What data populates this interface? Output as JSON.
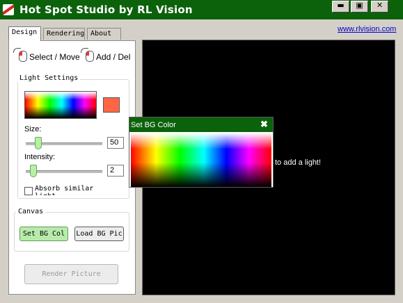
{
  "window": {
    "title": "Hot Spot Studio by RL Vision",
    "minimize_label": "▬",
    "maximize_label": "▣",
    "close_label": "✕"
  },
  "tabs": [
    {
      "label": "Design"
    },
    {
      "label": "Rendering"
    },
    {
      "label": "About"
    }
  ],
  "header_link": "www.rlvision.com",
  "modes": {
    "select_move": "Select / Move",
    "add_del": "Add / Del"
  },
  "light_settings": {
    "title": "Light Settings",
    "color": "#ff6644",
    "size_label": "Size:",
    "size_value": "50",
    "size_level": 0.12,
    "intensity_label": "Intensity:",
    "intensity_value": "2",
    "intensity_level": 0.05,
    "absorb_label": "Absorb similar light",
    "absorb_checked": false
  },
  "canvas_group": {
    "title": "Canvas",
    "set_bg_label": "Set BG Col",
    "load_bg_label": "Load BG Pic"
  },
  "render_button": "Render Picture",
  "canvas": {
    "hint": "to add a light!",
    "background": "#000000"
  },
  "popup": {
    "title": "Set BG Color",
    "close_label": "✖"
  },
  "icons": [
    "app-logo-icon",
    "mouse-icon",
    "close-icon"
  ],
  "colors": {
    "titlebar": "#0b620b",
    "accent_button": "#b8ebab"
  }
}
